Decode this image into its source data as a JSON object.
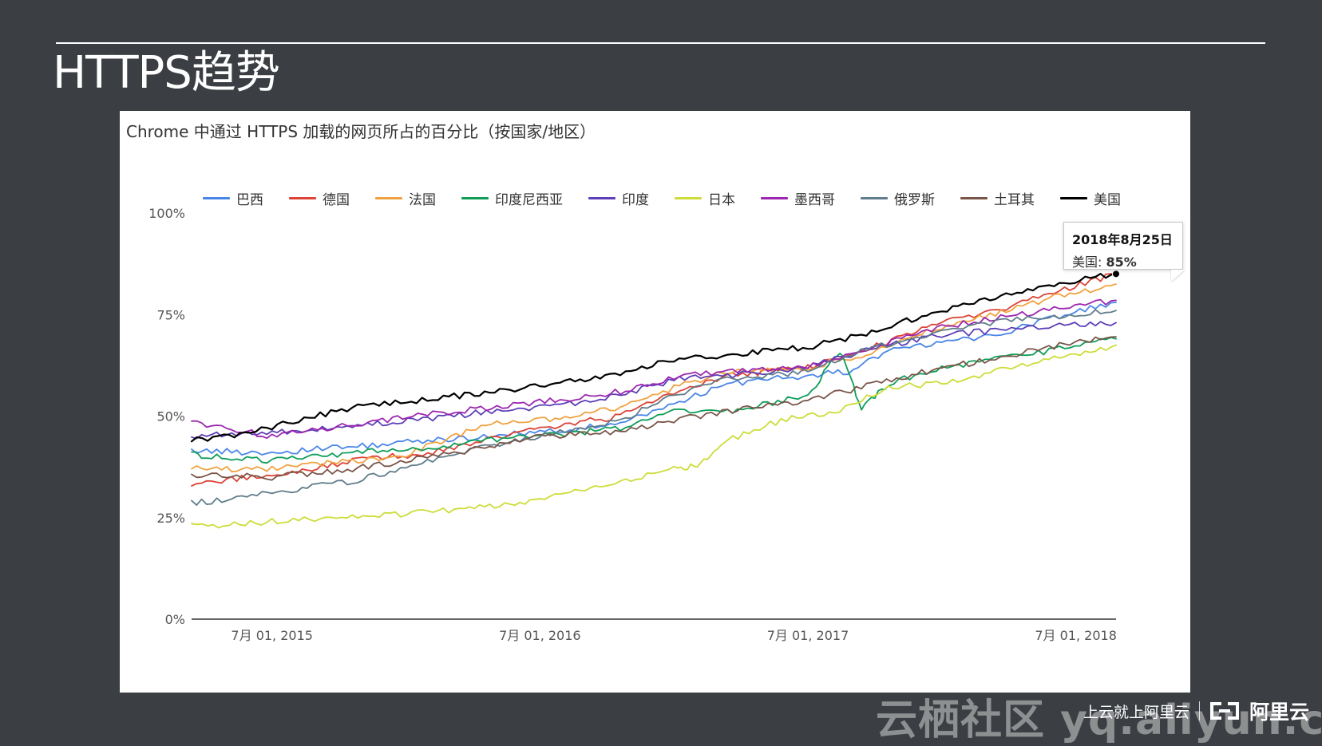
{
  "slide": {
    "title": "HTTPS趋势",
    "footer_slogan": "上云就上阿里云",
    "brand_name": "阿里云",
    "watermark_text": "云栖社区 yq.aliyun.com"
  },
  "chart": {
    "title": "Chrome 中通过 HTTPS 加载的网页所占的百分比（按国家/地区）",
    "tooltip": {
      "date": "2018年8月25日",
      "series_label": "美国:",
      "value_label": "85%"
    }
  },
  "chart_data": {
    "type": "line",
    "title": "Chrome 中通过 HTTPS 加载的网页所占的百分比（按国家/地区）",
    "x_ticks": [
      "7月 01, 2015",
      "7月 01, 2016",
      "7月 01, 2017",
      "7月 01, 2018"
    ],
    "x_tick_values": [
      2015.5,
      2016.5,
      2017.5,
      2018.5
    ],
    "y_ticks": [
      "0%",
      "25%",
      "50%",
      "75%",
      "100%"
    ],
    "y_tick_values": [
      0,
      25,
      50,
      75,
      100
    ],
    "ylim": [
      0,
      100
    ],
    "xlim": [
      2015.2,
      2018.65
    ],
    "legend_position": "top",
    "grid": false,
    "series": [
      {
        "name": "巴西",
        "color": "#4a86e8",
        "points": [
          [
            2015.2,
            41.5
          ],
          [
            2015.5,
            41
          ],
          [
            2015.8,
            42.5
          ],
          [
            2016.1,
            44
          ],
          [
            2016.5,
            46
          ],
          [
            2016.8,
            48
          ],
          [
            2017.0,
            53
          ],
          [
            2017.2,
            58
          ],
          [
            2017.5,
            60
          ],
          [
            2017.65,
            61
          ],
          [
            2017.8,
            66
          ],
          [
            2018.0,
            68
          ],
          [
            2018.2,
            70
          ],
          [
            2018.4,
            74
          ],
          [
            2018.65,
            78
          ]
        ]
      },
      {
        "name": "德国",
        "color": "#db4437",
        "points": [
          [
            2015.2,
            33.5
          ],
          [
            2015.5,
            35.5
          ],
          [
            2015.8,
            39
          ],
          [
            2016.1,
            41
          ],
          [
            2016.3,
            44
          ],
          [
            2016.5,
            47
          ],
          [
            2016.8,
            50
          ],
          [
            2017.0,
            56
          ],
          [
            2017.2,
            60
          ],
          [
            2017.5,
            62
          ],
          [
            2017.7,
            66
          ],
          [
            2018.0,
            73
          ],
          [
            2018.2,
            76
          ],
          [
            2018.4,
            80
          ],
          [
            2018.65,
            85
          ]
        ]
      },
      {
        "name": "法国",
        "color": "#f0a240",
        "points": [
          [
            2015.2,
            37
          ],
          [
            2015.5,
            37
          ],
          [
            2015.8,
            39
          ],
          [
            2016.0,
            40.5
          ],
          [
            2016.3,
            48
          ],
          [
            2016.5,
            49
          ],
          [
            2016.8,
            52
          ],
          [
            2017.0,
            57
          ],
          [
            2017.2,
            61
          ],
          [
            2017.5,
            62
          ],
          [
            2017.7,
            65
          ],
          [
            2018.0,
            72
          ],
          [
            2018.2,
            75
          ],
          [
            2018.4,
            79
          ],
          [
            2018.65,
            82.5
          ]
        ]
      },
      {
        "name": "印度尼西亚",
        "color": "#0f9d58",
        "points": [
          [
            2015.2,
            40.5
          ],
          [
            2015.5,
            39
          ],
          [
            2015.8,
            41
          ],
          [
            2016.1,
            42
          ],
          [
            2016.3,
            44
          ],
          [
            2016.5,
            45
          ],
          [
            2016.8,
            47
          ],
          [
            2017.0,
            51
          ],
          [
            2017.2,
            51
          ],
          [
            2017.5,
            55
          ],
          [
            2017.62,
            66
          ],
          [
            2017.7,
            52
          ],
          [
            2017.8,
            58
          ],
          [
            2018.0,
            62
          ],
          [
            2018.2,
            64
          ],
          [
            2018.4,
            66
          ],
          [
            2018.65,
            69
          ]
        ]
      },
      {
        "name": "印度",
        "color": "#5d3fb8",
        "points": [
          [
            2015.2,
            45
          ],
          [
            2015.5,
            46
          ],
          [
            2015.8,
            47.5
          ],
          [
            2016.1,
            49.5
          ],
          [
            2016.3,
            51
          ],
          [
            2016.5,
            52
          ],
          [
            2016.8,
            55
          ],
          [
            2017.0,
            59
          ],
          [
            2017.2,
            60
          ],
          [
            2017.5,
            62
          ],
          [
            2017.7,
            66
          ],
          [
            2018.0,
            70
          ],
          [
            2018.2,
            71
          ],
          [
            2018.4,
            72
          ],
          [
            2018.65,
            73
          ]
        ]
      },
      {
        "name": "日本",
        "color": "#cddc39",
        "points": [
          [
            2015.2,
            23
          ],
          [
            2015.4,
            23.5
          ],
          [
            2015.6,
            24.5
          ],
          [
            2015.8,
            25
          ],
          [
            2016.0,
            26
          ],
          [
            2016.2,
            27
          ],
          [
            2016.5,
            29.5
          ],
          [
            2016.8,
            34
          ],
          [
            2017.0,
            37
          ],
          [
            2017.1,
            38
          ],
          [
            2017.2,
            44
          ],
          [
            2017.4,
            49
          ],
          [
            2017.6,
            51
          ],
          [
            2017.8,
            57
          ],
          [
            2018.0,
            58
          ],
          [
            2018.2,
            61
          ],
          [
            2018.4,
            64
          ],
          [
            2018.65,
            67.5
          ]
        ]
      },
      {
        "name": "墨西哥",
        "color": "#9c27b0",
        "points": [
          [
            2015.2,
            48.5
          ],
          [
            2015.5,
            45
          ],
          [
            2015.8,
            48
          ],
          [
            2016.1,
            50.5
          ],
          [
            2016.3,
            52
          ],
          [
            2016.5,
            53.5
          ],
          [
            2016.8,
            56
          ],
          [
            2017.0,
            59.5
          ],
          [
            2017.2,
            61
          ],
          [
            2017.5,
            62
          ],
          [
            2017.7,
            66
          ],
          [
            2018.0,
            72
          ],
          [
            2018.2,
            74
          ],
          [
            2018.4,
            76
          ],
          [
            2018.65,
            78.5
          ]
        ]
      },
      {
        "name": "俄罗斯",
        "color": "#607d8b",
        "points": [
          [
            2015.2,
            28.5
          ],
          [
            2015.5,
            31
          ],
          [
            2015.8,
            34
          ],
          [
            2016.0,
            37
          ],
          [
            2016.2,
            41
          ],
          [
            2016.5,
            45
          ],
          [
            2016.8,
            49
          ],
          [
            2017.0,
            55
          ],
          [
            2017.2,
            59
          ],
          [
            2017.5,
            61
          ],
          [
            2017.7,
            66
          ],
          [
            2018.0,
            71
          ],
          [
            2018.2,
            73
          ],
          [
            2018.4,
            74.5
          ],
          [
            2018.65,
            76
          ]
        ]
      },
      {
        "name": "土耳其",
        "color": "#795548",
        "points": [
          [
            2015.2,
            35.5
          ],
          [
            2015.5,
            35
          ],
          [
            2015.8,
            37
          ],
          [
            2016.0,
            39
          ],
          [
            2016.2,
            41
          ],
          [
            2016.5,
            45
          ],
          [
            2016.8,
            46
          ],
          [
            2017.0,
            49
          ],
          [
            2017.2,
            51
          ],
          [
            2017.5,
            54
          ],
          [
            2017.7,
            57
          ],
          [
            2018.0,
            62
          ],
          [
            2018.2,
            64
          ],
          [
            2018.4,
            67
          ],
          [
            2018.65,
            69.5
          ]
        ]
      },
      {
        "name": "美国",
        "color": "#000000",
        "points": [
          [
            2015.2,
            44
          ],
          [
            2015.4,
            45.5
          ],
          [
            2015.6,
            49
          ],
          [
            2015.8,
            52
          ],
          [
            2016.0,
            53.5
          ],
          [
            2016.2,
            55
          ],
          [
            2016.5,
            57.5
          ],
          [
            2016.8,
            60
          ],
          [
            2017.0,
            64
          ],
          [
            2017.2,
            65
          ],
          [
            2017.5,
            67
          ],
          [
            2017.7,
            70
          ],
          [
            2018.0,
            76
          ],
          [
            2018.2,
            79.5
          ],
          [
            2018.4,
            82
          ],
          [
            2018.65,
            85
          ]
        ]
      }
    ]
  }
}
